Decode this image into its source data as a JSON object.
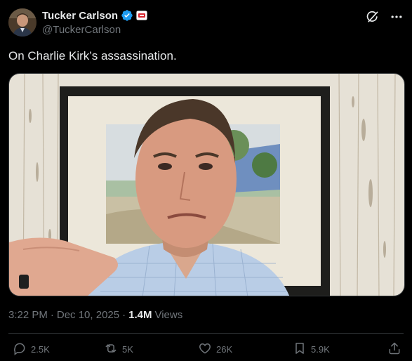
{
  "author": {
    "display_name": "Tucker Carlson",
    "handle": "@TuckerCarlson"
  },
  "post": {
    "text": "On Charlie Kirk’s assassination."
  },
  "meta": {
    "time": "3:22 PM",
    "date": "Dec 10, 2025",
    "views_count": "1.4M",
    "views_label": "Views",
    "separator": "·"
  },
  "actions": {
    "replies": "2.5K",
    "reposts": "5K",
    "likes": "26K",
    "bookmarks": "5.9K"
  },
  "colors": {
    "background": "#000000",
    "text_primary": "#e7e9ea",
    "text_secondary": "#71767b",
    "verified_blue": "#1d9bf0",
    "divider": "#2f3336"
  },
  "icons": [
    "avatar",
    "verified-badge-icon",
    "affiliate-flag-icon",
    "grok-icon",
    "more-icon",
    "reply-icon",
    "repost-icon",
    "like-icon",
    "bookmark-icon",
    "share-icon"
  ]
}
